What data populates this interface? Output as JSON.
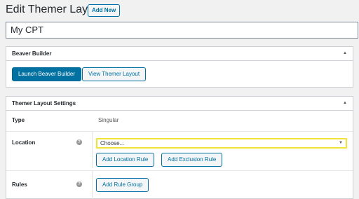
{
  "header": {
    "title": "Edit Themer Layout",
    "add_new_label": "Add New"
  },
  "post_title": {
    "value": "My CPT"
  },
  "beaver_builder_box": {
    "title": "Beaver Builder",
    "launch_label": "Launch Beaver Builder",
    "view_label": "View Themer Layout"
  },
  "settings_box": {
    "title": "Themer Layout Settings",
    "type": {
      "label": "Type",
      "value": "Singular"
    },
    "location": {
      "label": "Location",
      "select_value": "Choose...",
      "add_location_rule_label": "Add Location Rule",
      "add_exclusion_rule_label": "Add Exclusion Rule"
    },
    "rules": {
      "label": "Rules",
      "add_rule_group_label": "Add Rule Group"
    }
  },
  "icons": {
    "toggle": "triangle-up-icon",
    "help": "question-mark-icon",
    "dropdown": "triangle-down-icon"
  },
  "colors": {
    "primary": "#0071a1",
    "highlight": "#f0e43a"
  }
}
